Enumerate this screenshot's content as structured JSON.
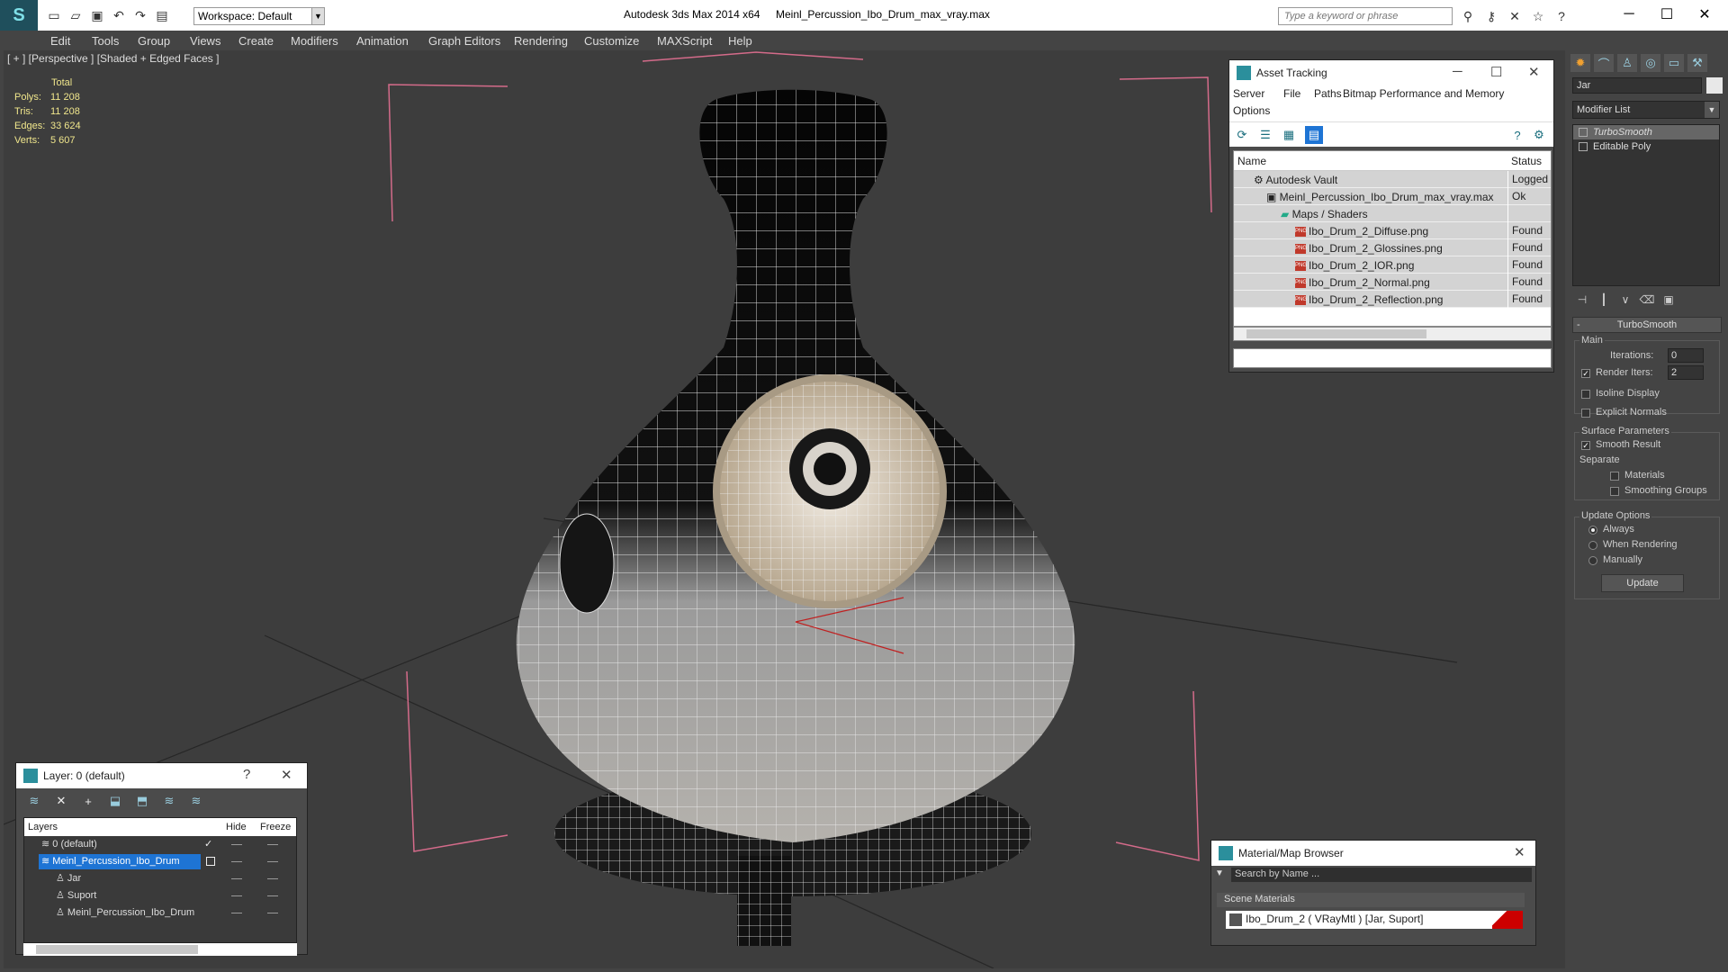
{
  "app": {
    "title": "Autodesk 3ds Max  2014 x64",
    "file": "Meinl_Percussion_Ibo_Drum_max_vray.max",
    "workspace": "Workspace: Default",
    "search_placeholder": "Type a keyword or phrase"
  },
  "menu": [
    "Edit",
    "Tools",
    "Group",
    "Views",
    "Create",
    "Modifiers",
    "Animation",
    "Graph Editors",
    "Rendering",
    "Customize",
    "MAXScript",
    "Help"
  ],
  "viewport": {
    "label": "[ + ] [Perspective ] [Shaded + Edged Faces ]",
    "stats": {
      "header": "Total",
      "rows": [
        {
          "k": "Polys:",
          "v": "11 208"
        },
        {
          "k": "Tris:",
          "v": "11 208"
        },
        {
          "k": "Edges:",
          "v": "33 624"
        },
        {
          "k": "Verts:",
          "v": "5 607"
        }
      ]
    }
  },
  "asset_tracking": {
    "title": "Asset Tracking",
    "menu": [
      "Server",
      "File",
      "Paths",
      "Bitmap Performance and Memory",
      "Options"
    ],
    "col_name": "Name",
    "col_status": "Status",
    "rows": [
      {
        "name": "Autodesk Vault",
        "status": "Logged O"
      },
      {
        "name": "Meinl_Percussion_Ibo_Drum_max_vray.max",
        "status": "Ok"
      },
      {
        "name": "Maps / Shaders",
        "status": ""
      },
      {
        "name": "Ibo_Drum_2_Diffuse.png",
        "status": "Found"
      },
      {
        "name": "Ibo_Drum_2_Glossines.png",
        "status": "Found"
      },
      {
        "name": "Ibo_Drum_2_IOR.png",
        "status": "Found"
      },
      {
        "name": "Ibo_Drum_2_Normal.png",
        "status": "Found"
      },
      {
        "name": "Ibo_Drum_2_Reflection.png",
        "status": "Found"
      }
    ],
    "png_badge": "PNG"
  },
  "command_panel": {
    "object_name": "Jar",
    "modifier_list": "Modifier List",
    "stack": [
      "TurboSmooth",
      "Editable Poly"
    ],
    "rollout": {
      "title": "TurboSmooth",
      "main": "Main",
      "iterations_label": "Iterations:",
      "iterations_value": "0",
      "render_iters_label": "Render Iters:",
      "render_iters_value": "2",
      "isoline": "Isoline Display",
      "explicit_normals": "Explicit Normals",
      "surface_params": "Surface Parameters",
      "smooth_result": "Smooth Result",
      "separate": "Separate",
      "materials": "Materials",
      "smoothing_groups": "Smoothing Groups",
      "update_options": "Update Options",
      "always": "Always",
      "when_rendering": "When Rendering",
      "manually": "Manually",
      "update_button": "Update"
    }
  },
  "layer_window": {
    "title": "Layer: 0 (default)",
    "col_layers": "Layers",
    "col_hide": "Hide",
    "col_freeze": "Freeze",
    "rows": [
      "0 (default)",
      "Meinl_Percussion_Ibo_Drum",
      "Jar",
      "Suport",
      "Meinl_Percussion_Ibo_Drum"
    ]
  },
  "material_browser": {
    "title": "Material/Map Browser",
    "search_placeholder": "Search by Name ...",
    "section": "Scene Materials",
    "item": "Ibo_Drum_2  ( VRayMtl ) [Jar, Suport]"
  }
}
